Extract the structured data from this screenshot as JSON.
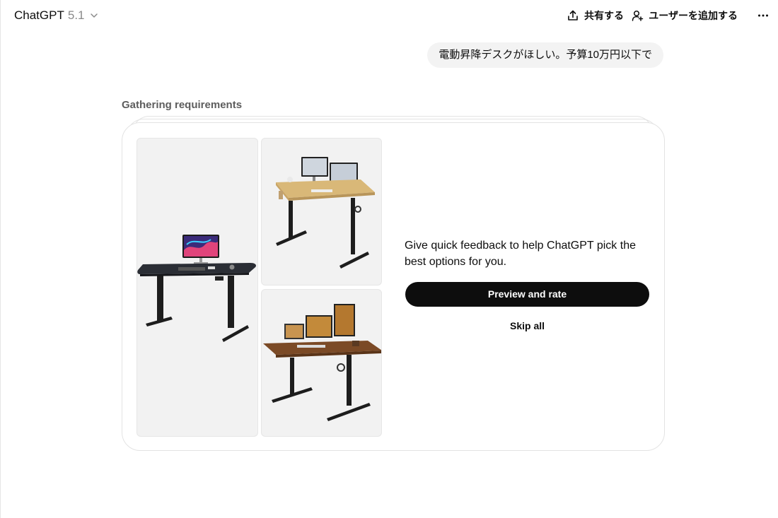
{
  "header": {
    "model_name": "ChatGPT",
    "model_version": "5.1",
    "share_label": "共有する",
    "add_user_label": "ユーザーを追加する"
  },
  "conversation": {
    "user_message": "電動昇降デスクがほしい。予算10万円以下で"
  },
  "shopping": {
    "status_label": "Gathering requirements",
    "products": [
      {
        "name": "black-standing-desk-with-monitor",
        "top_color": "#2b2e35"
      },
      {
        "name": "light-wood-standing-desk-with-dual-monitors",
        "top_color": "#d9b878"
      },
      {
        "name": "walnut-standing-desk-with-monitors",
        "top_color": "#7b4a26"
      }
    ],
    "feedback_text": "Give quick feedback to help ChatGPT pick the best options for you.",
    "preview_button": "Preview and rate",
    "skip_button": "Skip all"
  },
  "icons": {
    "share": "share-icon",
    "add_user": "add-user-icon",
    "more": "more-icon",
    "chevron": "chevron-down-icon"
  }
}
